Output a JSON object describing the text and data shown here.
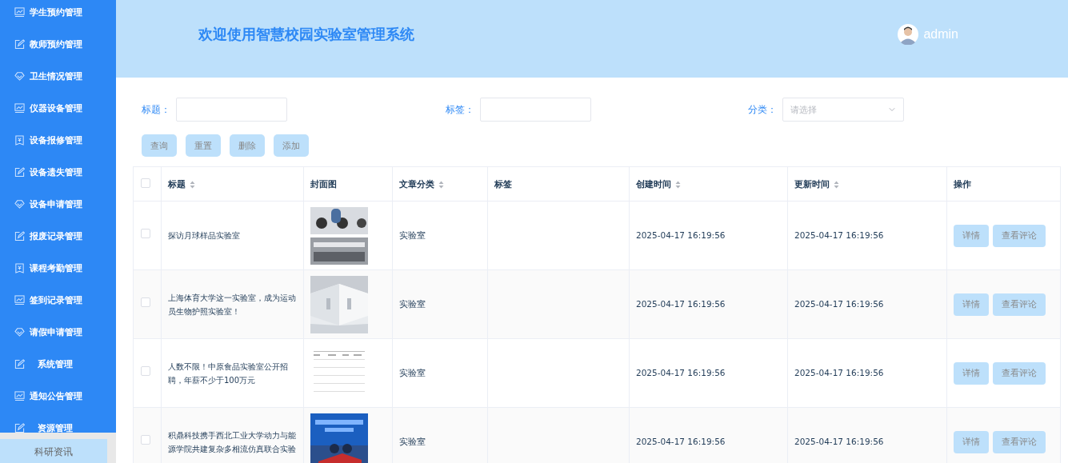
{
  "sidebar": {
    "items": [
      {
        "label": "学生预约管理",
        "kind": "chart"
      },
      {
        "label": "教师预约管理",
        "kind": "edit"
      },
      {
        "label": "卫生情况管理",
        "kind": "diamond"
      },
      {
        "label": "仪器设备管理",
        "kind": "chart"
      },
      {
        "label": "设备报修管理",
        "kind": "ticket"
      },
      {
        "label": "设备遗失管理",
        "kind": "edit"
      },
      {
        "label": "设备申请管理",
        "kind": "diamond"
      },
      {
        "label": "报废记录管理",
        "kind": "edit"
      },
      {
        "label": "课程考勤管理",
        "kind": "ticket"
      },
      {
        "label": "签到记录管理",
        "kind": "chart"
      },
      {
        "label": "请假申请管理",
        "kind": "diamond"
      },
      {
        "label": "系统管理",
        "kind": "edit"
      },
      {
        "label": "通知公告管理",
        "kind": "chart"
      },
      {
        "label": "资源管理",
        "kind": "edit"
      }
    ],
    "bottom_item": {
      "label": "科研资讯"
    }
  },
  "header": {
    "title": "欢迎使用智慧校园实验室管理系统",
    "user": "admin"
  },
  "filters": [
    {
      "label": "标题：",
      "kind": "input"
    },
    {
      "label": "标签：",
      "kind": "input"
    },
    {
      "label": "分类：",
      "kind": "select",
      "placeholder": "请选择"
    }
  ],
  "actions": [
    "查询",
    "重置",
    "删除",
    "添加"
  ],
  "table": {
    "header_checked": false,
    "columns": [
      {
        "label": "标题",
        "sortable": true
      },
      {
        "label": "封面图",
        "sortable": false
      },
      {
        "label": "文章分类",
        "sortable": true
      },
      {
        "label": "标签",
        "sortable": false
      },
      {
        "label": "创建时间",
        "sortable": true
      },
      {
        "label": "更新时间",
        "sortable": true
      },
      {
        "label": "操作",
        "sortable": false
      }
    ],
    "rows": [
      {
        "checked": false,
        "title": "探访月球样品实验室",
        "cover": {
          "kind": "picture"
        },
        "category": "实验室",
        "created": "2025-04-17 16:19:56",
        "updated": "2025-04-17 16:19:56",
        "actions": [
          "详情",
          "查看评论"
        ]
      },
      {
        "checked": false,
        "title": "上海体育大学这一实验室，成为运动员生物护照实验室！",
        "cover": {
          "kind": "picture"
        },
        "category": "实验室",
        "created": "2025-04-17 16:19:56",
        "updated": "2025-04-17 16:19:56",
        "actions": [
          "详情",
          "查看评论"
        ]
      },
      {
        "checked": false,
        "title": "人数不限！中原食品实验室公开招聘，年薪不少于100万元",
        "cover": {
          "kind": "picture"
        },
        "category": "实验室",
        "created": "2025-04-17 16:19:56",
        "updated": "2025-04-17 16:19:56",
        "actions": [
          "详情",
          "查看评论"
        ]
      },
      {
        "checked": false,
        "title": "积鼎科技携手西北工业大学动力与能源学院共建复杂多相流仿真联合实验",
        "cover": {
          "kind": "picture"
        },
        "category": "实验室",
        "created": "2025-04-17 16:19:56",
        "updated": "2025-04-17 16:19:56",
        "actions": [
          "详情",
          "查看评论"
        ]
      }
    ]
  }
}
